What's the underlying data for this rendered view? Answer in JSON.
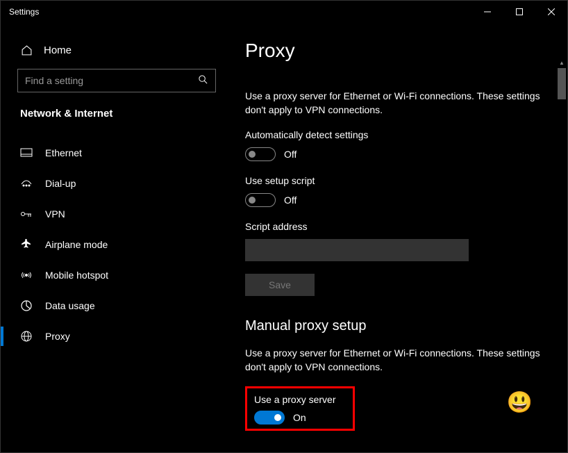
{
  "titlebar": {
    "title": "Settings"
  },
  "sidebar": {
    "home_label": "Home",
    "search_placeholder": "Find a setting",
    "section": "Network & Internet",
    "items": [
      {
        "label": "Ethernet",
        "selected": false
      },
      {
        "label": "Dial-up",
        "selected": false
      },
      {
        "label": "VPN",
        "selected": false
      },
      {
        "label": "Airplane mode",
        "selected": false
      },
      {
        "label": "Mobile hotspot",
        "selected": false
      },
      {
        "label": "Data usage",
        "selected": false
      },
      {
        "label": "Proxy",
        "selected": true
      }
    ]
  },
  "main": {
    "title": "Proxy",
    "desc1": "Use a proxy server for Ethernet or Wi-Fi connections. These settings don't apply to VPN connections.",
    "auto_detect": {
      "label": "Automatically detect settings",
      "state": "Off"
    },
    "setup_script": {
      "label": "Use setup script",
      "state": "Off"
    },
    "script_address_label": "Script address",
    "script_address_value": "",
    "save_label": "Save",
    "manual_heading": "Manual proxy setup",
    "desc2": "Use a proxy server for Ethernet or Wi-Fi connections. These settings don't apply to VPN connections.",
    "use_proxy": {
      "label": "Use a proxy server",
      "state": "On"
    }
  }
}
